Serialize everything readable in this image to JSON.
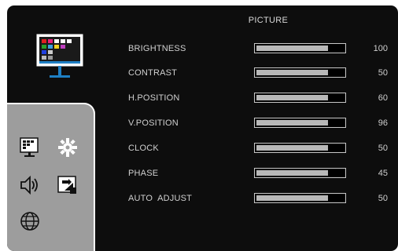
{
  "menu": {
    "title": "PICTURE",
    "items": [
      {
        "label": "BRIGHTNESS",
        "value": "100",
        "level": 0.82
      },
      {
        "label": "CONTRAST",
        "value": "50",
        "level": 0.82
      },
      {
        "label": "H.POSITION",
        "value": "60",
        "level": 0.82
      },
      {
        "label": "V.POSITION",
        "value": "96",
        "level": 0.82
      },
      {
        "label": "CLOCK",
        "value": "50",
        "level": 0.82
      },
      {
        "label": "PHASE",
        "value": "45",
        "level": 0.82
      },
      {
        "label": "AUTO  ADJUST",
        "value": "50",
        "level": 0.82
      }
    ]
  },
  "sidebar": {
    "icons": [
      "picture-icon",
      "settings-gear-icon",
      "audio-speaker-icon",
      "input-source-icon",
      "language-globe-icon"
    ]
  },
  "colors": {
    "background": "#0d0d0d",
    "sidebar": "#9d9d9d",
    "accent_blue": "#1e7fc4"
  }
}
